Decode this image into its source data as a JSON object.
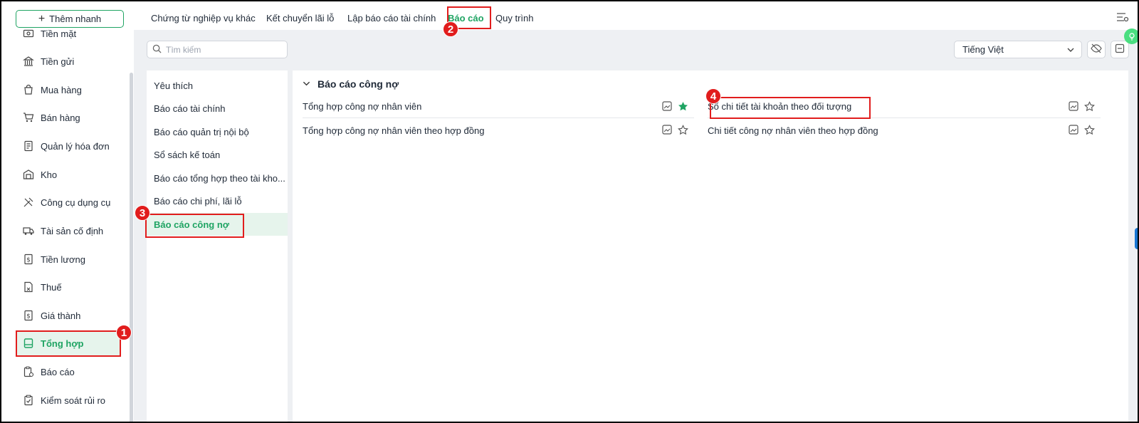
{
  "sidebar": {
    "quick_add": "Thêm nhanh",
    "items": [
      {
        "label": "Tiền mặt",
        "icon": "cash-icon"
      },
      {
        "label": "Tiền gửi",
        "icon": "bank-icon"
      },
      {
        "label": "Mua hàng",
        "icon": "shopping-bag-icon"
      },
      {
        "label": "Bán hàng",
        "icon": "cart-icon"
      },
      {
        "label": "Quản lý hóa đơn",
        "icon": "invoice-icon"
      },
      {
        "label": "Kho",
        "icon": "warehouse-icon"
      },
      {
        "label": "Công cụ dụng cụ",
        "icon": "tools-icon"
      },
      {
        "label": "Tài sản cố định",
        "icon": "truck-icon"
      },
      {
        "label": "Tiền lương",
        "icon": "salary-icon"
      },
      {
        "label": "Thuế",
        "icon": "tax-icon"
      },
      {
        "label": "Giá thành",
        "icon": "price-icon"
      },
      {
        "label": "Tổng hợp",
        "icon": "summary-icon"
      },
      {
        "label": "Báo cáo",
        "icon": "report-icon"
      },
      {
        "label": "Kiểm soát rủi ro",
        "icon": "risk-icon"
      }
    ],
    "active": "Tổng hợp"
  },
  "tabs": {
    "items": [
      "Chứng từ nghiệp vụ khác",
      "Kết chuyển lãi lỗ",
      "Lập báo cáo tài chính",
      "Báo cáo",
      "Quy trình"
    ],
    "active": "Báo cáo"
  },
  "toolbar": {
    "search_placeholder": "Tìm kiếm",
    "language": "Tiếng Việt"
  },
  "categories": {
    "items": [
      "Yêu thích",
      "Báo cáo tài chính",
      "Báo cáo quản trị nội bộ",
      "Sổ sách kế toán",
      "Báo cáo tổng hợp theo tài kho...",
      "Báo cáo chi phí, lãi lỗ",
      "Báo cáo công nợ"
    ],
    "active": "Báo cáo công nợ"
  },
  "section": {
    "title": "Báo cáo công nợ",
    "reports": [
      {
        "label": "Tổng hợp công nợ nhân viên",
        "favorite": true
      },
      {
        "label": "Tổng hợp công nợ nhân viên theo hợp đồng",
        "favorite": false
      },
      {
        "label": "Sổ chi tiết tài khoản theo đối tượng",
        "favorite": false
      },
      {
        "label": "Chi tiết công nợ nhân viên theo hợp đồng",
        "favorite": false
      }
    ]
  },
  "annotations": [
    "1",
    "2",
    "3",
    "4"
  ],
  "colors": {
    "accent": "#1fa463",
    "highlight": "#e11d1d",
    "main_bg": "#eef0f3"
  }
}
